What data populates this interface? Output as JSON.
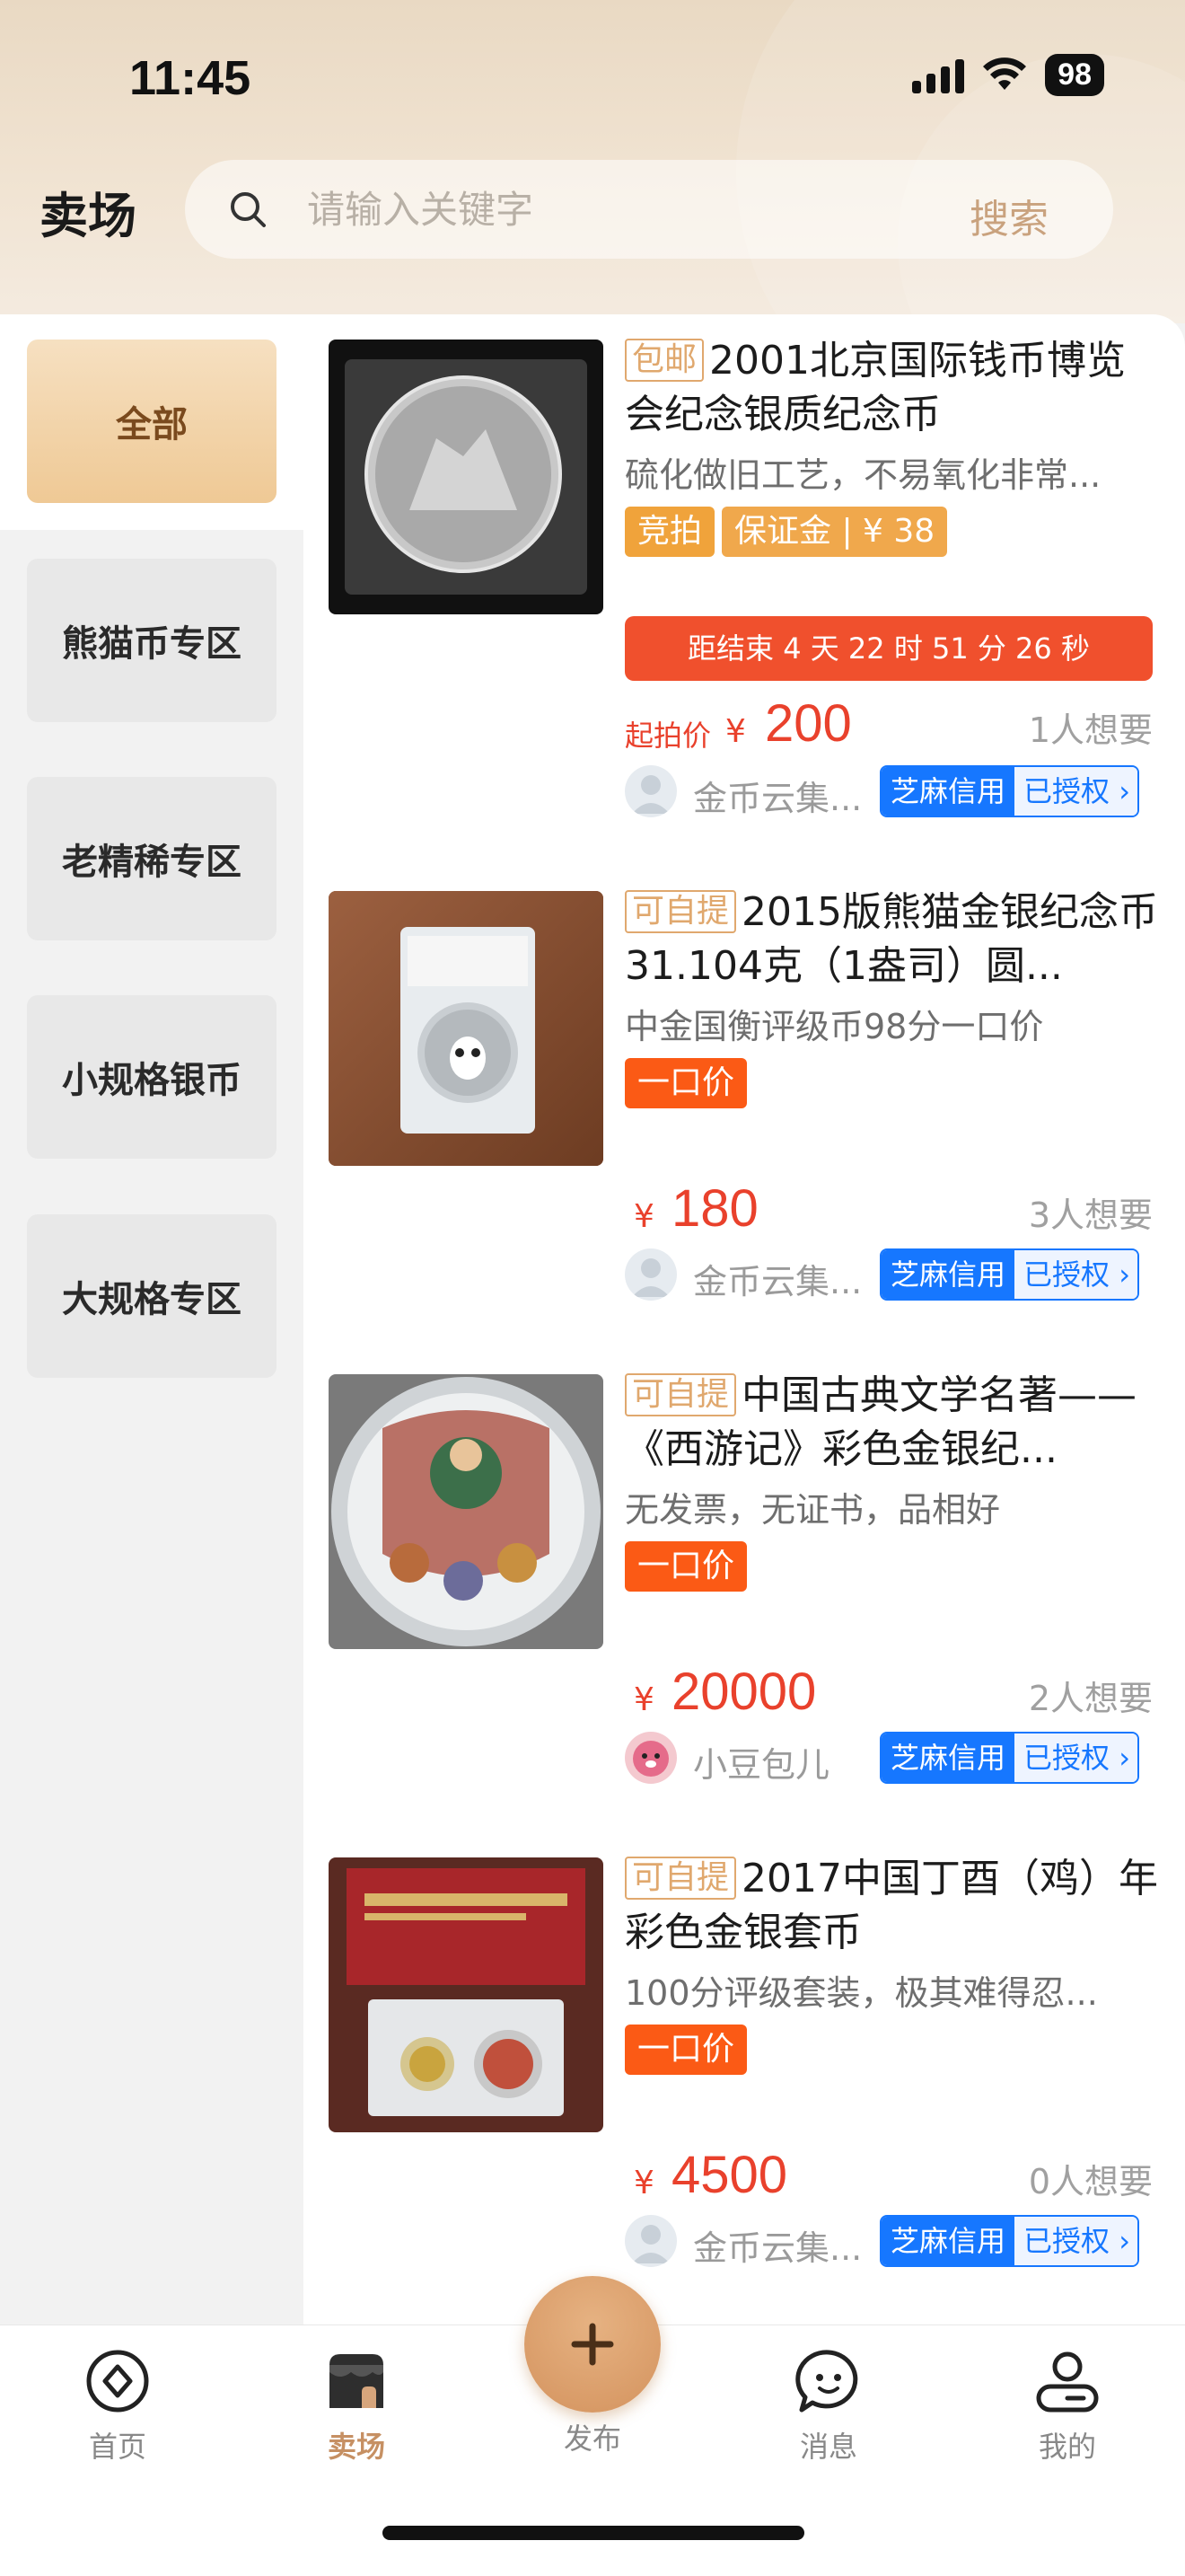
{
  "status_bar": {
    "time": "11:45",
    "battery": "98"
  },
  "header": {
    "title": "卖场",
    "search_placeholder": "请输入关键字",
    "search_button": "搜索"
  },
  "sidebar": {
    "items": [
      {
        "label": "全部",
        "active": true
      },
      {
        "label": "熊猫币专区",
        "active": false
      },
      {
        "label": "老精稀专区",
        "active": false
      },
      {
        "label": "小规格银币",
        "active": false
      },
      {
        "label": "大规格专区",
        "active": false
      }
    ]
  },
  "listings": [
    {
      "tag": "包邮",
      "title": "2001北京国际钱币博览会纪念银质纪念币",
      "description": "硫化做旧工艺，不易氧化非常...",
      "badges": [
        "竞拍",
        "保证金 | ¥ 38"
      ],
      "countdown": "距结束 4 天 22 时 51 分 26 秒",
      "price_label": "起拍价",
      "currency": "¥",
      "price": "200",
      "wants": "1人想要",
      "seller": "金币云集...",
      "credit_label": "芝麻信用",
      "credit_status": "已授权 ›"
    },
    {
      "tag": "可自提",
      "title": "2015版熊猫金银纪念币31.104克（1盎司）圆...",
      "description": "中金国衡评级币98分一口价",
      "badges": [
        "一口价"
      ],
      "currency": "¥",
      "price": "180",
      "wants": "3人想要",
      "seller": "金币云集...",
      "credit_label": "芝麻信用",
      "credit_status": "已授权 ›"
    },
    {
      "tag": "可自提",
      "title": "中国古典文学名著——《西游记》彩色金银纪...",
      "description": "无发票，无证书，品相好",
      "badges": [
        "一口价"
      ],
      "currency": "¥",
      "price": "20000",
      "wants": "2人想要",
      "seller": "小豆包儿",
      "credit_label": "芝麻信用",
      "credit_status": "已授权 ›"
    },
    {
      "tag": "可自提",
      "title": "2017中国丁酉（鸡）年彩色金银套币",
      "description": "100分评级套装，极其难得忍...",
      "badges": [
        "一口价"
      ],
      "currency": "¥",
      "price": "4500",
      "wants": "0人想要",
      "seller": "金币云集...",
      "credit_label": "芝麻信用",
      "credit_status": "已授权 ›"
    }
  ],
  "bottom_nav": {
    "items": [
      {
        "label": "首页",
        "icon": "home-compass-icon"
      },
      {
        "label": "卖场",
        "icon": "store-icon",
        "active": true
      },
      {
        "label": "发布",
        "icon": "plus-icon"
      },
      {
        "label": "消息",
        "icon": "chat-bubble-icon"
      },
      {
        "label": "我的",
        "icon": "profile-icon"
      }
    ]
  },
  "colors": {
    "accent": "#c69063",
    "price": "#e9412c",
    "credit_blue": "#1677ff",
    "countdown": "#f0502d"
  }
}
